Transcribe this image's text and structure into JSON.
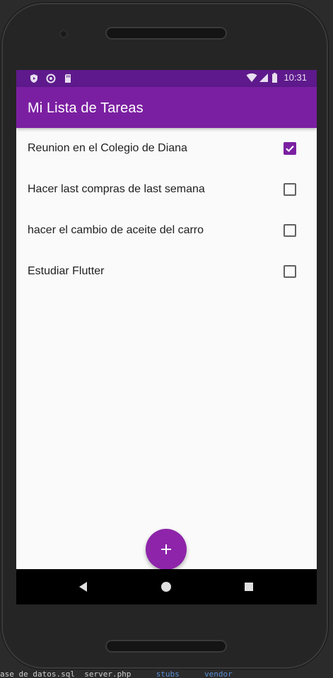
{
  "status_bar": {
    "time": "10:31",
    "left_icons": [
      "play-protect-icon",
      "sync-icon",
      "sd-card-icon"
    ],
    "right_icons": [
      "wifi-icon",
      "signal-icon",
      "battery-icon"
    ]
  },
  "app_bar": {
    "title": "Mi Lista de Tareas",
    "color": "#7b1fa2"
  },
  "tasks": [
    {
      "label": "Reunion en el Colegio de Diana",
      "checked": true
    },
    {
      "label": "Hacer last compras de last semana",
      "checked": false
    },
    {
      "label": "hacer el cambio de aceite del carro",
      "checked": false
    },
    {
      "label": "Estudiar Flutter",
      "checked": false
    }
  ],
  "fab": {
    "icon": "plus-icon",
    "color": "#8e24aa"
  },
  "nav_bar": {
    "buttons": [
      "back-icon",
      "home-icon",
      "recents-icon"
    ]
  },
  "background_text": {
    "left": "ase de datos.sql   server.php",
    "links": [
      "stubs",
      "vendor"
    ]
  }
}
